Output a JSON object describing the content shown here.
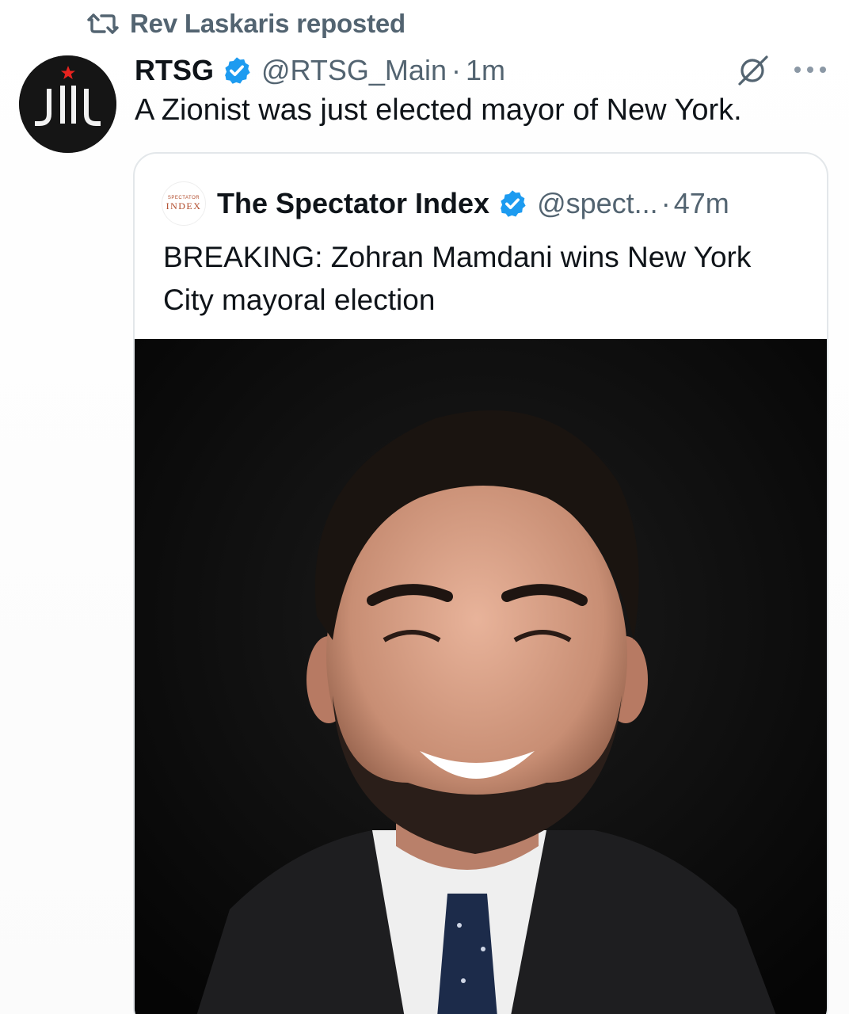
{
  "repost": {
    "icon": "repost-icon",
    "text": "Rev Laskaris reposted"
  },
  "tweet": {
    "author_name": "RTSG",
    "verified": true,
    "handle": "@RTSG_Main",
    "separator": "·",
    "time": "1m",
    "text": "A Zionist was just elected mayor of New York.",
    "avatar_text": "JIL",
    "icons": [
      "grok-icon",
      "more-icon"
    ]
  },
  "quote": {
    "author_name": "The Spectator Index",
    "verified": true,
    "handle": "@spect...",
    "separator": "·",
    "time": "47m",
    "avatar_top": "SPECTATOR",
    "avatar_bottom": "INDEX",
    "text": "BREAKING: Zohran Mamdani wins New York City mayoral election",
    "media": "portrait-photo"
  },
  "colors": {
    "text_primary": "#0f1419",
    "text_secondary": "#536471",
    "verified_blue": "#1d9bf0",
    "card_border": "#e3e7ea",
    "avatar_star_red": "#e8231f"
  }
}
